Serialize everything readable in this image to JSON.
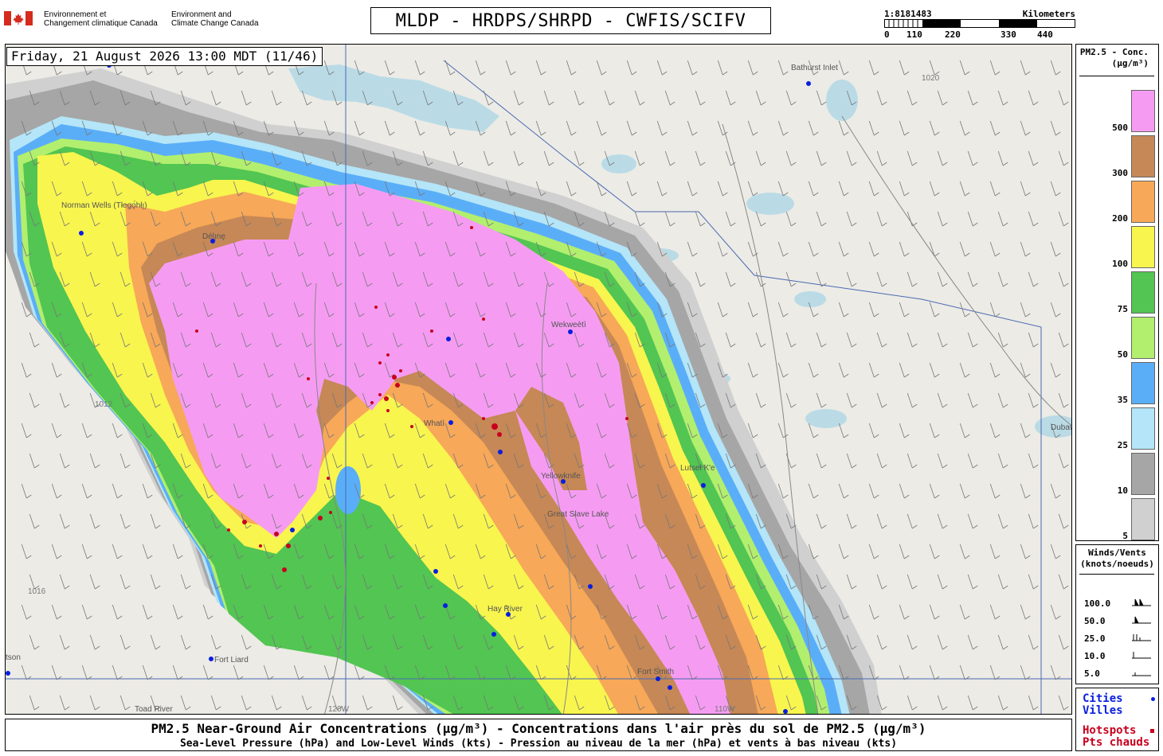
{
  "header": {
    "org_fr": "Environnement et\nChangement climatique Canada",
    "org_en": "Environment and\nClimate Change Canada",
    "title": "MLDP - HRDPS/SHRPD - CWFIS/SCIFV",
    "scale_ratio": "1:8181483",
    "scale_unit": "Kilometers",
    "scale_ticks": [
      "0",
      "110",
      "220",
      "330",
      "440"
    ]
  },
  "map": {
    "datetime": "Friday, 21 August 2026 13:00 MDT (11/46)",
    "cities": [
      "Bathurst Inlet",
      "Norman Wells (Tłegǫ́hłı̨)",
      "Délı̨nę",
      "Wekweètì",
      "Whatì",
      "Yellowknife",
      "Great Slave Lake",
      "Hay River",
      "Fort Liard",
      "Fort Smith",
      "Lutsel K'e",
      "Toad River",
      "Dubawnt Lake",
      "tson"
    ],
    "isobars": [
      "1012",
      "1016",
      "1020"
    ],
    "longitude_label": "120W",
    "longitude_label_2": "110W"
  },
  "legend": {
    "title": "PM2.5 - Conc.\n(µg/m³)",
    "bins": [
      {
        "label": "500",
        "color": "#f59cf2"
      },
      {
        "label": "300",
        "color": "#c68856"
      },
      {
        "label": "200",
        "color": "#f7a858"
      },
      {
        "label": "100",
        "color": "#f8f54e"
      },
      {
        "label": "75",
        "color": "#52c552"
      },
      {
        "label": "50",
        "color": "#b2ef6e"
      },
      {
        "label": "35",
        "color": "#5aaef8"
      },
      {
        "label": "25",
        "color": "#b4e5f8"
      },
      {
        "label": "10",
        "color": "#a6a6a6"
      },
      {
        "label": "5",
        "color": "#d0d0d0"
      }
    ]
  },
  "wind_legend": {
    "title": "Winds/Vents\n(knots/noeuds)",
    "values": [
      "100.0",
      "50.0",
      "25.0",
      "10.0",
      "5.0"
    ]
  },
  "key": {
    "cities": "Cities\nVilles",
    "hotspots": "Hotspots\nPts chauds",
    "city_color": "#0a1ee0",
    "hotspot_color": "#c8001e"
  },
  "footer": {
    "line1": "PM2.5 Near-Ground Air Concentrations (µg/m³) - Concentrations dans l'air près du sol de PM2.5 (µg/m³)",
    "line2": "Sea-Level Pressure (hPa) and Low-Level Winds (kts) - Pression au niveau de la mer (hPa) et vents à bas niveau (kts)"
  }
}
